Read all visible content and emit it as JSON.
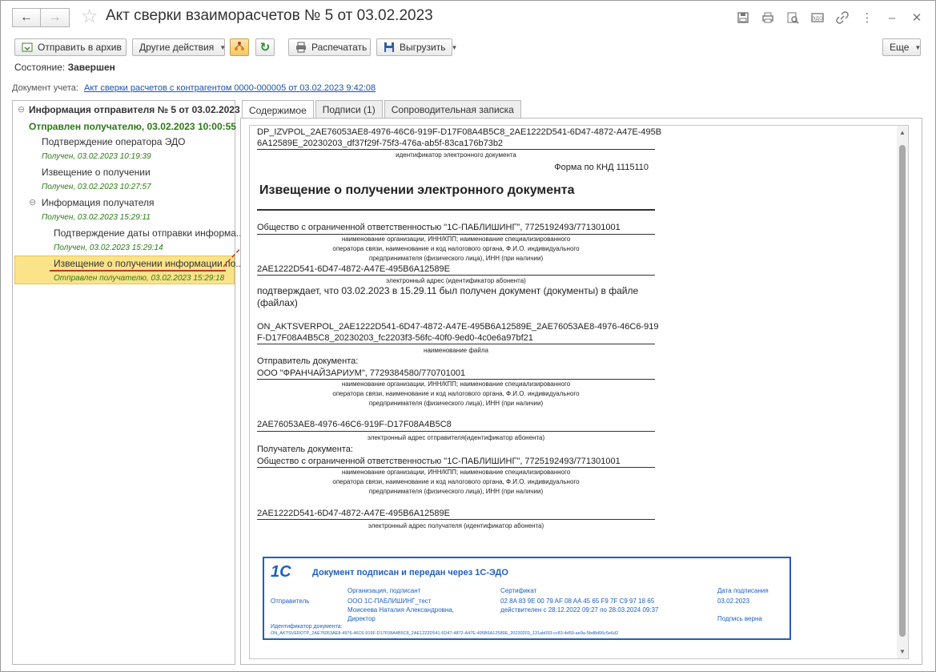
{
  "window": {
    "title": "Акт сверки взаиморасчетов № 5 от 03.02.2023"
  },
  "toolbar": {
    "archive": "Отправить в архив",
    "other": "Другие действия",
    "print": "Распечатать",
    "export": "Выгрузить",
    "more": "Еще"
  },
  "status": {
    "label": "Состояние:",
    "value": "Завершен"
  },
  "accounting_doc": {
    "label": "Документ учета:",
    "link": "Акт сверки расчетов с контрагентом 0000-000005 от 03.02.2023 9:42:08"
  },
  "tree": {
    "root": "Информация отправителя № 5 от 03.02.2023",
    "sent": "Отправлен получателю, 03.02.2023 10:00:55",
    "items": [
      {
        "label": "Подтверждение оператора ЭДО",
        "sub": "Получен, 03.02.2023 10:19:39"
      },
      {
        "label": "Извещение о получении",
        "sub": "Получен, 03.02.2023 10:27:57"
      },
      {
        "label": "Информация получателя",
        "sub": "Получен, 03.02.2023 15:29:11"
      },
      {
        "label": "Подтверждение даты отправки информа...",
        "sub": "Получен, 03.02.2023 15:29:14"
      },
      {
        "label": "Извещение о получении информации по...",
        "sub": "Отправлен получателю, 03.02.2023 15:29:18"
      }
    ]
  },
  "tabs": [
    "Содержимое",
    "Подписи (1)",
    "Сопроводительная записка"
  ],
  "doc": {
    "file_line1": "DP_IZVPOL_2AE76053AE8-4976-46C6-919F-D17F08A4B5C8_2AE1222D541-6D47-4872-A47E-495B",
    "file_line2": "6A12589E_20230203_df37f29f-75f3-476a-ab5f-83ca176b73b2",
    "file_caption": "идентификатор электронного документа",
    "knd": "Форма по КНД 1115110",
    "heading": "Извещение о получении электронного документа",
    "org1": "Общество с ограниченной ответственностью \"1С-ПАБЛИШИНГ\", 7725192493/771301001",
    "org_caption1": "наименование организации, ИНН/КПП; наименование специализированного",
    "org_caption2": "оператора связи, наименование и код налогового органа, Ф.И.О. индивидуального",
    "org_caption3": "предпринимателя (физического лица), ИНН (при наличии)",
    "addr1": "2AE1222D541-6D47-4872-A47E-495B6A12589E",
    "addr_caption1": "электронный адрес (идентификатор абонента)",
    "confirm1": "подтверждает, что 03.02.2023 в 15.29.11 был получен документ (документы) в файле",
    "confirm2": "(файлах)",
    "fname1": "ON_AKTSVERPOL_2AE1222D541-6D47-4872-A47E-495B6A12589E_2AE76053AE8-4976-46C6-919",
    "fname2": "F-D17F08A4B5C8_20230203_fc2203f3-56fc-40f0-9ed0-4c0e6a97bf21",
    "fname_caption": "наименование файла",
    "sender_label": "Отправитель документа:",
    "sender_org": "ООО \"ФРАНЧАЙЗАРИУМ\", 7729384580/770701001",
    "sender_addr": "2AE76053AE8-4976-46C6-919F-D17F08A4B5C8",
    "sender_addr_caption": "электронный адрес отправителя(идентификатор абонента)",
    "receiver_label": "Получатель документа:",
    "receiver_org": "Общество с ограниченной ответственностью \"1С-ПАБЛИШИНГ\", 7725192493/771301001",
    "receiver_addr": "2AE1222D541-6D47-4872-A47E-495B6A12589E",
    "receiver_addr_caption": "электронный адрес получателя (идентификатор абонента)"
  },
  "stamp": {
    "logo": "1С",
    "title": "Документ подписан и передан через 1С-ЭДО",
    "col_org": "Организация, подписант",
    "col_cert": "Сертификат",
    "col_date": "Дата подписания",
    "role": "Отправитель",
    "org": "ООО 1С-ПАБЛИШИНГ_тест",
    "person": "Моисеева Наталия Александровна,",
    "position": "Директор",
    "cert": "02 8A 83 9E 00 79 AF 08 AA 45 65 F9 7F C9 97 18 65",
    "cert_valid": "действителен с 28.12.2022 09:27 по 28.03.2024 09:37",
    "date": "03.02.2023",
    "sig_ok": "Подпись верна",
    "docid_label": "Идентификатор документа:",
    "docid": "ON_AKTSVEROTP_2AE76053AE8-4976-46C6-919F-D17F08A4B5C8_2AE1222D541-6D47-4872-A47E-495B6A12589E_20230203_131ab093-cc83-4d59-ae9a-5bd8d06c5e6d2"
  },
  "colors": {
    "accent": "#1f5fc0",
    "selection": "#fbe38a",
    "green": "#2a7a16",
    "link": "#1a52b3"
  }
}
